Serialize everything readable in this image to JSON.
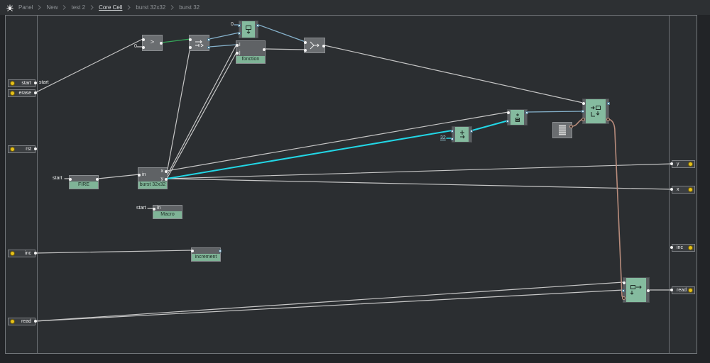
{
  "breadcrumb": {
    "icon": "structure-icon",
    "items": [
      "Panel",
      "New",
      "test 2",
      "Core Cell",
      "burst 32x32",
      "burst 32"
    ]
  },
  "inputs": {
    "start": {
      "label": "start",
      "wire_label": "start"
    },
    "erase": {
      "label": "erase"
    },
    "rst": {
      "label": "rst"
    },
    "inc": {
      "label": "inc"
    },
    "read": {
      "label": "read"
    }
  },
  "outputs": {
    "y": {
      "label": "y"
    },
    "x": {
      "label": "x"
    },
    "inc": {
      "label": "inc"
    },
    "read": {
      "label": "read"
    }
  },
  "modules": {
    "compare": {
      "symbol": ">",
      "constant": "0",
      "icon": "compare-icon"
    },
    "latch": {
      "icon": "latch-icon"
    },
    "register": {
      "constant": "0",
      "icon": "value-register-icon"
    },
    "fonction": {
      "label": "fonction",
      "in_i": "i",
      "in_j": "j"
    },
    "router": {
      "icon": "router-icon"
    },
    "array_write": {
      "icon": "array-write-icon"
    },
    "array": {
      "icon": "array-table-icon"
    },
    "index_a": {
      "icon": "array-index-icon"
    },
    "index_b": {
      "icon": "adder-icon",
      "constant": "32"
    },
    "burst": {
      "label": "burst 32x32",
      "in": "in",
      "out_x": "x",
      "out_y": "y"
    },
    "fire": {
      "label": "FIRE",
      "in_label": "start"
    },
    "macro": {
      "label": "Macro",
      "in": "in",
      "in_label": "start"
    },
    "increment": {
      "label": "increment"
    },
    "array_read": {
      "icon": "array-read-icon"
    }
  },
  "colors": {
    "background": "#2b2e31",
    "module_gray": "#6a6d70",
    "module_teal": "#85bb9f",
    "macro_label": "#7fb497",
    "port_led": "#e5c01b",
    "wire": "#c6c6c6",
    "wire_green": "#36a85a",
    "wire_blue": "#86b2cc",
    "wire_cyan": "#22d7e6",
    "wire_brown": "#b88c7c"
  }
}
